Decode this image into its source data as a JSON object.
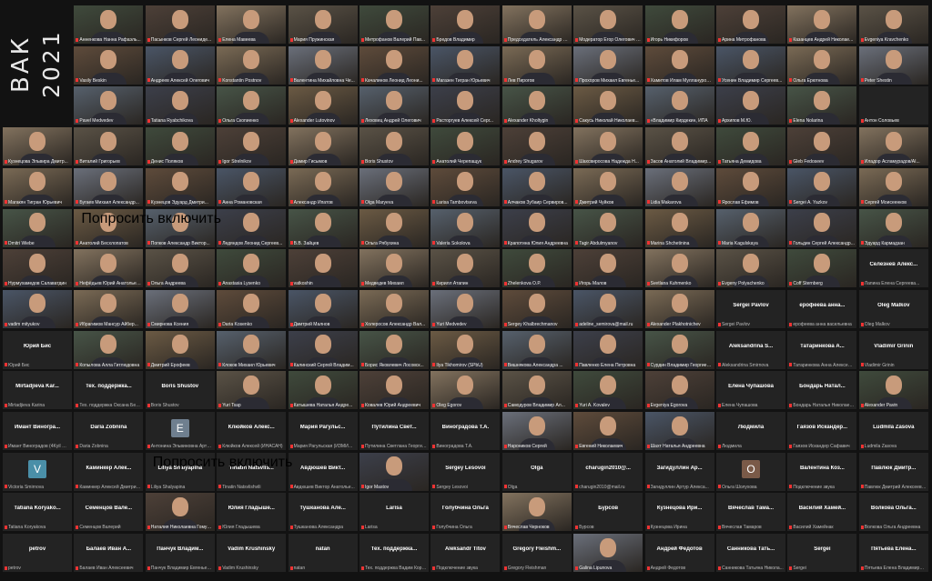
{
  "sidebar": {
    "title": "ВАК",
    "year": "2021"
  },
  "start_col": [
    1,
    1,
    1,
    0,
    0,
    0,
    0,
    0,
    0,
    0,
    0,
    0,
    0,
    0,
    0
  ],
  "speaker": [
    4,
    0
  ],
  "badges": [
    {
      "r": 5,
      "c": 1,
      "text": "Попросить включить"
    },
    {
      "r": 11,
      "c": 2,
      "text": "Попросить включить"
    }
  ],
  "palette": [
    "#5a5246",
    "#4a5566",
    "#6b5a44",
    "#3f4a3c",
    "#7a6a55",
    "#56606c",
    "#4d4038",
    "#6a6f7a",
    "#3c3f4a",
    "#82725e",
    "#5e4b3b",
    "#475447"
  ],
  "rows": [
    [
      {
        "n": "Анненкова Нанна Рафаэль..."
      },
      {
        "n": "Пасынков Сергей Леониде..."
      },
      {
        "n": "Елена Мавеева"
      },
      {
        "n": "Мария Пружинская"
      },
      {
        "n": "Митрофанов Валерий Пав..."
      },
      {
        "n": "Бредов Владимир"
      },
      {
        "n": "Председатель Александр Вл..."
      },
      {
        "n": "Модератор Егор Олегович М..."
      },
      {
        "n": "Игорь Никифоров"
      },
      {
        "n": "Арина Митрофанова"
      },
      {
        "n": "Казанцев Андрей Николае..."
      },
      {
        "n": "Evgeniya Kravchenko"
      }
    ],
    [
      {
        "n": "Vasily Beskin"
      },
      {
        "n": "Андреев Алексей Олегович"
      },
      {
        "n": "Konstantin Postnov"
      },
      {
        "n": "Валентина Михайловна Че..."
      },
      {
        "n": "Качалинов Леонид Леони..."
      },
      {
        "n": "Магазен Тигран Юрьевич"
      },
      {
        "n": "Лев Пирогов"
      },
      {
        "n": "Прохоров Михаил Евгенье..."
      },
      {
        "n": "Хамитов Илам Мулланурович"
      },
      {
        "n": "Усенин Владимир Сергеев..."
      },
      {
        "n": "Ольга Ерютнова"
      },
      {
        "n": "Peter Shestin"
      }
    ],
    [
      {
        "n": "Pavel Medvedev"
      },
      {
        "n": "Tatiana Ryabchikova"
      },
      {
        "n": "Ольга Скопиенко"
      },
      {
        "n": "Alexander Lutovinov"
      },
      {
        "n": "Леховец Андрей Олегович"
      },
      {
        "n": "Расторгуев Алексей Серг..."
      },
      {
        "n": "Alexander Kholtygin"
      },
      {
        "n": "Сакусь Николай Николаев..."
      },
      {
        "n": "«Владимир Кирдекин, ИПА"
      },
      {
        "n": "Архипов М.Ю."
      },
      {
        "n": "Elena Nolarina"
      },
      {
        "n": "Антон Соловьев",
        "a": 1
      }
    ],
    [
      {
        "n": "Кузнецова Эльвира Дмитр..."
      },
      {
        "n": "Виталий Григорьев"
      },
      {
        "n": "Денис Поляков"
      },
      {
        "n": "Igor Strelnikov"
      },
      {
        "n": "Дамир Гисымов"
      },
      {
        "n": "Boris Shustov"
      },
      {
        "n": "Анатолий Черепащук"
      },
      {
        "n": "Andrey Shugarov"
      },
      {
        "n": "Шахсвиросова Надежда Н..."
      },
      {
        "n": "Засов Анатолий Владимир..."
      },
      {
        "n": "Татьяна Демидова"
      },
      {
        "n": "Gleb Fedoseev"
      },
      {
        "n": "Иладор Асламурадов/AI..."
      }
    ],
    [
      {
        "n": "Магакян Тигран Юрьевич"
      },
      {
        "n": "Бугаев Михаил Александр..."
      },
      {
        "n": "Кузнецов Эдуард Дмитри..."
      },
      {
        "n": "Анна Романовская"
      },
      {
        "n": "Александр Ипатов"
      },
      {
        "n": "Olga Maryeva"
      },
      {
        "n": "Larisa Tambovtseva"
      },
      {
        "n": "Алчаков Зубаир Сервиров..."
      },
      {
        "n": "Дмитрий Чуйков"
      },
      {
        "n": "Lidia Makarova"
      },
      {
        "n": "Ярослав Ёфимов"
      },
      {
        "n": "Sergei A. Yazkov"
      },
      {
        "n": "Сергей Моисеенков"
      }
    ],
    [
      {
        "n": "Dmitri Wiebe"
      },
      {
        "n": "Анатолий Бесхлопатов"
      },
      {
        "n": "Попков Александр Виктор..."
      },
      {
        "n": "Ледяндов Леонид Сергеев..."
      },
      {
        "n": "В.В. Зайцев"
      },
      {
        "n": "Ольга Рябухина"
      },
      {
        "n": "Valeria Sokolova"
      },
      {
        "n": "Крапотина Юлия Андреевна"
      },
      {
        "n": "Tagir Abdulmyanov"
      },
      {
        "n": "Marina Shchetinina"
      },
      {
        "n": "Maria Kagulskaya"
      },
      {
        "n": "Гольдин Сергей Александр..."
      },
      {
        "n": "Эдуард Кармадзан"
      }
    ],
    [
      {
        "n": "Нурмухамедов Салаватдин"
      },
      {
        "n": "Нефёдьев Юрий Анатольев..."
      },
      {
        "n": "Ольга Андреева"
      },
      {
        "n": "Anastasia Lysenko"
      },
      {
        "n": "vatkoshin"
      },
      {
        "n": "Медведев Михаил"
      },
      {
        "n": "Кирилл Атапин"
      },
      {
        "n": "Zhelenkova O.P."
      },
      {
        "n": "Игорь Малов"
      },
      {
        "n": "Svetlana Kuhmenko"
      },
      {
        "n": "Evgeny Polyachenko"
      },
      {
        "n": "Сoff Sternberg"
      },
      {
        "n": "Лапина Елена Сергеева...",
        "t": "Селезнев Алекс..."
      }
    ],
    [
      {
        "n": "vadim mityukov"
      },
      {
        "n": "Ибрагимов Мансур Айбер..."
      },
      {
        "n": "Смирнова Ксения"
      },
      {
        "n": "Daria Kosenko"
      },
      {
        "n": "Дмитрий Малнов"
      },
      {
        "n": "Холеросов Александр Вал..."
      },
      {
        "n": "Yuri Medvedev"
      },
      {
        "n": "Sergey Khalbrechmanov"
      },
      {
        "n": "adeline_semirova@mail.ru"
      },
      {
        "n": "Alexander Plakhotnichev"
      },
      {
        "n": "Sergei Pavlov",
        "t": "Sergei Pavlov"
      },
      {
        "n": "ерофеева анна васильевна",
        "t": "ерофеева анна..."
      },
      {
        "n": "Oleg Malkov",
        "t": "Oleg Malkov"
      }
    ],
    [
      {
        "n": "Юрий Бис",
        "t": "Юрий Бис"
      },
      {
        "n": "Копылова Алла Гитлюдовна"
      },
      {
        "n": "Дмитрий Ерофеев"
      },
      {
        "n": "Клоков Михаил Юрьевич"
      },
      {
        "n": "Калинский Сергей Владим..."
      },
      {
        "n": "Борис Яковлевич Лосовск..."
      },
      {
        "n": "Ilya Tikhomirov (SPbU)"
      },
      {
        "n": "Вишнякова Александра ..."
      },
      {
        "n": "Павленко Елена Петровна"
      },
      {
        "n": "Сурдин Владимир Георгиевич"
      },
      {
        "n": "Aleksandrina Smirnova",
        "t": "Aleksandrina S..."
      },
      {
        "n": "Татаринкова Анна Алексеевна",
        "t": "Татаринкова А..."
      },
      {
        "n": "Vladimir Grinin",
        "t": "Vladimir Grinin"
      }
    ],
    [
      {
        "n": "Mirtadjieva Karina",
        "t": "Mirtadjieva Kar..."
      },
      {
        "n": "Тех. поддержка Оксана Белова",
        "t": "Тех. поддержка..."
      },
      {
        "n": "Boris Shustov",
        "t": "Boris Shustov"
      },
      {
        "n": "Yuri Tsap"
      },
      {
        "n": "Катышева Наталья Андре..."
      },
      {
        "n": "Ковалев Юрий Андреевич"
      },
      {
        "n": "Oleg Egorov"
      },
      {
        "n": "Самодуров Владимир Ал..."
      },
      {
        "n": "Yuri A. Kovalev"
      },
      {
        "n": "Evgeniya Egorova"
      },
      {
        "n": "Елена Чупашова",
        "t": "Елена Чупашова"
      },
      {
        "n": "Бондарь Наталья Николаевна",
        "t": "Бондарь Натал..."
      },
      {
        "n": "Alexander Pavin"
      }
    ],
    [
      {
        "n": "Имант Виноградов (4Kyil Wen)",
        "t": "Имант Виногра..."
      },
      {
        "n": "Daria Zobnina",
        "t": "Daria Zobnina"
      },
      {
        "n": "Антонина Эльвиновна Артуро...",
        "t": "E",
        "av": "#6f7f8f"
      },
      {
        "n": "Клюйков Алексей (ИНАСАН)",
        "t": "Клюйков Алекс..."
      },
      {
        "n": "Мария Рагульская (ИЗМИРА...)",
        "t": "Мария Рагульс..."
      },
      {
        "n": "Путилина Светлана Георгиевна",
        "t": "Путилина Свет..."
      },
      {
        "n": "Виноградова Т.А.",
        "t": "Виноградова Т.А."
      },
      {
        "n": "Нароников Сергей"
      },
      {
        "n": "Евгений Николаевич"
      },
      {
        "n": "Шахт Наталья Андреевна"
      },
      {
        "n": "Людмила",
        "t": "Людмила"
      },
      {
        "n": "Гаязов Искандер Сафавич",
        "t": "Гаязов Искандер..."
      },
      {
        "n": "Ludmila Zasova",
        "t": "Ludmila Zasova"
      }
    ],
    [
      {
        "n": "Victoria Smirnova",
        "t": "V",
        "av": "#4a8fa8"
      },
      {
        "n": "Каминкер Алексей Дмитриевич",
        "t": "Каминкер Алек..."
      },
      {
        "n": "Liliya Shalyapina",
        "t": "Liliya Shalyapina"
      },
      {
        "n": "Tinatin Natsvlishvili",
        "t": "Tinatin Natsvlis..."
      },
      {
        "n": "Авдюшев Виктор Анатолье...",
        "t": "Авдюшев Викт..."
      },
      {
        "n": "Igor Mastov"
      },
      {
        "n": "Sergey Lesovoi",
        "t": "Sergey Lesovoi"
      },
      {
        "n": "Olga",
        "t": "Olga"
      },
      {
        "n": "charugin2010@mail.ru",
        "t": "charugin2010@..."
      },
      {
        "n": "Загидуллин Артур Алекса...",
        "t": "Загидуллин Ар..."
      },
      {
        "n": "Ольга Шолухова",
        "t": "O",
        "av": "#7a5a48"
      },
      {
        "n": "Подключение звука",
        "t": "Валентина Коз..."
      },
      {
        "n": "Павлюк Дмитрий Алексеевич",
        "t": "Павлюк Дмитр..."
      }
    ],
    [
      {
        "n": "Tatiana Koryakova",
        "t": "Tatiana Koryako..."
      },
      {
        "n": "Семенцов Валерий",
        "t": "Семенцов Вале..."
      },
      {
        "n": "Наталия Николаевна Гомули..."
      },
      {
        "n": "Юлия Гладышева",
        "t": "Юлия Гладыше..."
      },
      {
        "n": "Тушканова Александра",
        "t": "Тушканова Але..."
      },
      {
        "n": "Larisa",
        "t": "Larisa"
      },
      {
        "n": "Голубчина Ольга",
        "t": "Голубчина Ольга"
      },
      {
        "n": "Вячеслав Черноков"
      },
      {
        "n": "Бурсов",
        "t": "Бурсов"
      },
      {
        "n": "Кузнецова Ирина",
        "t": "Кузнецова Ири..."
      },
      {
        "n": "Вячеслав Тамаров",
        "t": "Вячеслав Тама..."
      },
      {
        "n": "Василий Хамейнак",
        "t": "Василий Хамей..."
      },
      {
        "n": "Волкова Ольга Андреевна",
        "t": "Волкова Ольга..."
      }
    ],
    [
      {
        "n": "petrov",
        "t": "petrov"
      },
      {
        "n": "Балаев Иван Алексеевич",
        "t": "Балаев Иван А..."
      },
      {
        "n": "Панчук Владимир Евгеньевич",
        "t": "Панчук Владим..."
      },
      {
        "n": "Vadim Krushinsky",
        "t": "Vadim Krushinsky"
      },
      {
        "n": "natan",
        "t": "natan"
      },
      {
        "n": "Тех. поддержка Вадим Корн...",
        "t": "Тех. поддержка..."
      },
      {
        "n": "Подключение звука",
        "t": "Aleksandr Titov"
      },
      {
        "n": "Gregory Fleishman",
        "t": "Gregory Fleishm..."
      },
      {
        "n": "Galina Lipunova"
      },
      {
        "n": "Андрей Федотов",
        "t": "Андрей Федотов"
      },
      {
        "n": "Санникова Татьяна Никола...",
        "t": "Санникова Тать..."
      },
      {
        "n": "Sergei",
        "t": "Sergei"
      },
      {
        "n": "Пятьева Елена Владимировна",
        "t": "Пятьева Елена..."
      }
    ]
  ]
}
